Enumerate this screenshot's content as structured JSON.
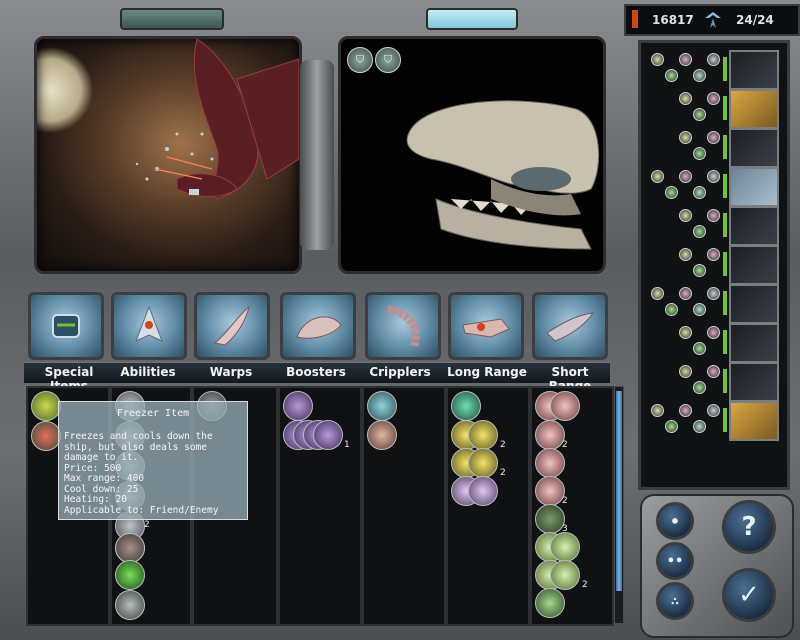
{
  "stats": {
    "credits": "16817",
    "fleet_count": "24/24",
    "indicator_color": "#d0451b"
  },
  "tabs": [
    {
      "label": "Special Items",
      "icon": "special-items-icon"
    },
    {
      "label": "Abilities",
      "icon": "abilities-icon"
    },
    {
      "label": "Warps",
      "icon": "warps-icon"
    },
    {
      "label": "Boosters",
      "icon": "boosters-icon"
    },
    {
      "label": "Cripplers",
      "icon": "cripplers-icon"
    },
    {
      "label": "Long Range",
      "icon": "long-range-icon"
    },
    {
      "label": "Short Range",
      "icon": "short-range-icon"
    }
  ],
  "tooltip": {
    "title": "Freezer Item",
    "body": "Freezes and cools down the\nship, but also deals some\ndamage to it.\nPrice: 500\nMax range: 400\nCool down: 25\nHeating: 20\nApplicable to: Friend/Enemy"
  },
  "columns": {
    "special_items": [
      "freezer-item",
      "red-item"
    ],
    "abilities": [
      "gray-ability",
      "gray-ability",
      "gray-ability",
      "gray-ability",
      "gray-ability",
      "gray-ability",
      "ghost-ability",
      "green-bolt-ability",
      "shield-ability"
    ],
    "abilities_counts": {
      "5": "2"
    },
    "warps": [
      "gray-warp"
    ],
    "boosters": [
      "purple-booster",
      "purple-booster",
      "purple-booster",
      "purple-booster",
      "purple-booster"
    ],
    "boosters_counts": {
      "stack": "1"
    },
    "cripplers": [
      "cyan-crippler",
      "ring-crippler"
    ],
    "long_range": [
      "green-long",
      "yellow-long",
      "yellow-long",
      "purple-long"
    ],
    "long_range_counts": {
      "1": "2",
      "2": "2"
    },
    "short_range": [
      "red-short",
      "red-short",
      "red-short",
      "red-short",
      "green-short",
      "green-short",
      "green-short",
      "green-short",
      "green-short"
    ],
    "short_range_counts": {
      "1": "2",
      "3": "2",
      "4": "3",
      "7": "2"
    }
  },
  "fleet": [
    {
      "portrait": "dark",
      "selected": false
    },
    {
      "portrait": "gold",
      "selected": false
    },
    {
      "portrait": "dark",
      "selected": false
    },
    {
      "portrait": "dark",
      "selected": true
    },
    {
      "portrait": "dark",
      "selected": false
    },
    {
      "portrait": "dark",
      "selected": false
    },
    {
      "portrait": "dark",
      "selected": false
    },
    {
      "portrait": "dark",
      "selected": false
    },
    {
      "portrait": "dark",
      "selected": false
    },
    {
      "portrait": "gold",
      "selected": false
    }
  ],
  "controls": {
    "help_symbol": "?",
    "confirm_symbol": "✓",
    "dot_symbol": "•"
  },
  "colors": {
    "accent_blue": "#7fb3df",
    "energy_green": "#6fc23a"
  }
}
